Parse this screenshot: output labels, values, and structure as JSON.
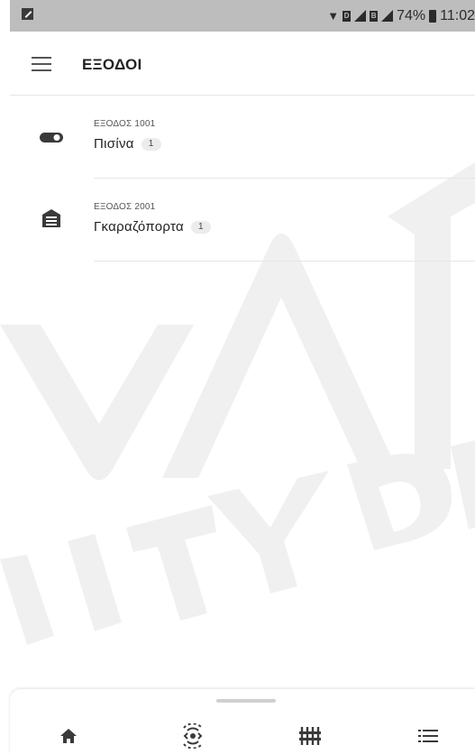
{
  "status_bar": {
    "battery": "74%",
    "time": "11:02",
    "signal1_label": "D",
    "signal2_label": "B"
  },
  "header": {
    "title": "ΕΞΟΔΟΙ",
    "menu_icon": "menu-icon"
  },
  "outputs": [
    {
      "subtitle": "ΕΞΟΔΟΣ 1001",
      "name": "Πισίνα",
      "badge": "1",
      "icon": "toggle-icon"
    },
    {
      "subtitle": "ΕΞΟΔΟΣ 2001",
      "name": "Γκαραζόπορτα",
      "badge": "1",
      "icon": "garage-icon"
    }
  ],
  "bottom_nav": [
    {
      "icon": "home-icon"
    },
    {
      "icon": "sensor-icon"
    },
    {
      "icon": "controls-icon"
    },
    {
      "icon": "list-icon"
    }
  ],
  "watermark_text": "NVAT SECURITY DI"
}
